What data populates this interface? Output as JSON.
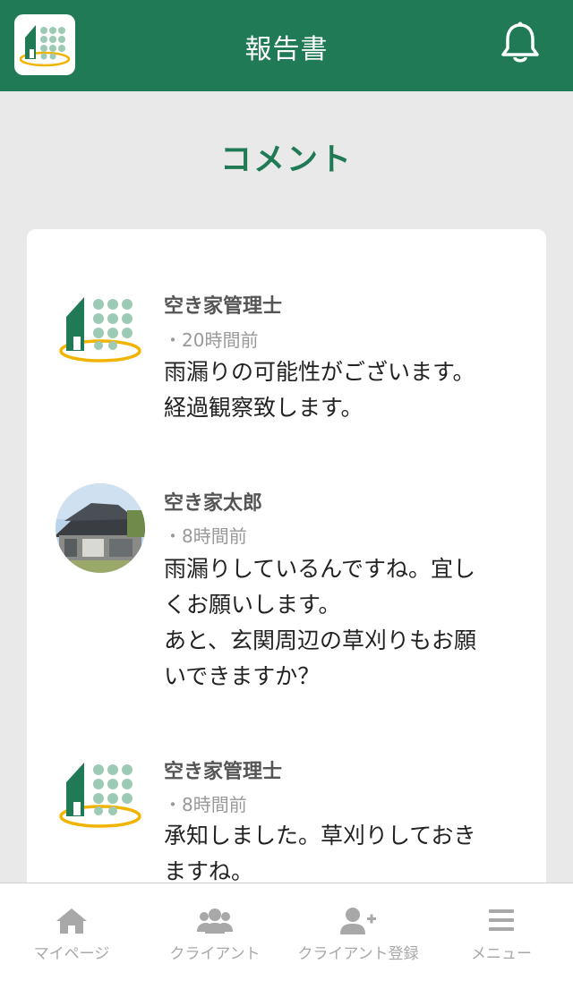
{
  "header": {
    "title": "報告書",
    "logo_icon": "house-logo-icon",
    "notification_icon": "bell-icon"
  },
  "page": {
    "title": "コメント"
  },
  "comments": [
    {
      "author": "空き家管理士",
      "time": "・20時間前",
      "text": "雨漏りの可能性がございます。\n経過観察致します。",
      "avatar": "company-logo"
    },
    {
      "author": "空き家太郎",
      "time": "・8時間前",
      "text": "雨漏りしているんですね。宜し\nくお願いします。\nあと、玄関周辺の草刈りもお願\nいできますか？",
      "avatar": "house-photo"
    },
    {
      "author": "空き家管理士",
      "time": "・8時間前",
      "text": "承知しました。草刈りしておき\nますね。",
      "avatar": "company-logo"
    }
  ],
  "tabbar": {
    "items": [
      {
        "label": "マイページ",
        "icon": "home-icon"
      },
      {
        "label": "クライアント",
        "icon": "users-icon"
      },
      {
        "label": "クライアント登録",
        "icon": "user-plus-icon"
      },
      {
        "label": "メニュー",
        "icon": "menu-icon"
      }
    ]
  },
  "colors": {
    "brand_green": "#1f7a55",
    "logo_dots": "#9ccab4",
    "logo_ring": "#f0b400",
    "background": "#e9e9e9",
    "inactive_tab": "#a8a8a8"
  }
}
